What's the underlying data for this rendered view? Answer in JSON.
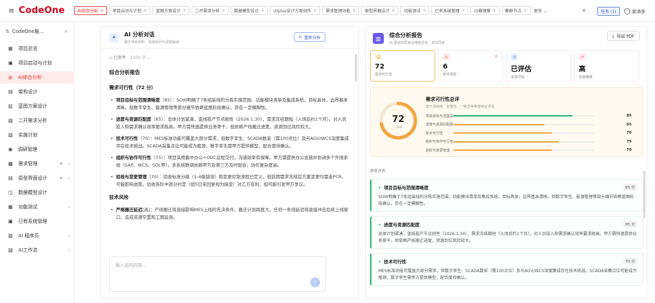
{
  "topbar": {
    "logo": "CodeOne",
    "tabs": [
      {
        "label": "AI综合分析",
        "active": true
      },
      {
        "label": "项目启动与计划"
      },
      {
        "label": "蓝图方案设计"
      },
      {
        "label": "二开需求分析"
      },
      {
        "label": "数据模型设计"
      },
      {
        "label": "Utplus设计方案创作"
      },
      {
        "label": "需求管理功能"
      },
      {
        "label": "原型界面设计"
      },
      {
        "label": "功能测试"
      },
      {
        "label": "已有系统管理"
      },
      {
        "label": "沙箱镜像"
      },
      {
        "label": "集群节点"
      }
    ],
    "more_label": "更多",
    "task_label": "任务 (1)",
    "user_name": "郭涛多"
  },
  "sidebar": {
    "project": "CodeOne施...",
    "items": [
      {
        "label": "项目总览"
      },
      {
        "label": "项目启动与计划"
      },
      {
        "label": "AI综合分析",
        "active": true
      },
      {
        "label": "架构设计"
      },
      {
        "label": "蓝图方案设计"
      },
      {
        "label": "二开需求分析"
      },
      {
        "label": "实施计划"
      },
      {
        "label": "调研管理"
      },
      {
        "label": "需求管理",
        "plus": true,
        "chev": true
      },
      {
        "label": "原型界面设计",
        "plus": true,
        "chev": true
      },
      {
        "label": "数据模型设计"
      },
      {
        "label": "功能测试",
        "chev": true
      },
      {
        "label": "已有系统管理"
      },
      {
        "label": "AI 程序员",
        "chev": true
      },
      {
        "label": "AI工作流",
        "chev": true
      }
    ]
  },
  "chat": {
    "title": "AI 分析对话",
    "subtitle": "基于项目材料 · 支持追问与深度解读",
    "regen_label": "重新分析",
    "thought_label": "已思考",
    "thought_count": "1100 字",
    "report_heading": "综合分析报告",
    "section1": "需求可行性（72 分）",
    "bullets": [
      {
        "b": "项目目标与范围清晰度",
        "t": "（85）：SOW明确了7条组装线的分拣实施范围、功能模块清单及集成系统，目标具体，边界基本清晰。但数字孪生、能源管理等部分细节依赖蓝图阶段确认，存在一定模糊性。"
      },
      {
        "b": "进度与资源匹配度",
        "t": "（65）：总体计划紧凑，蓝线投产节点刚性（2026.1.30），需求冻结期短（入场后约1个月）。对人员投入和需求确认效率要求极高。甲方需快速提供业务骨干，但依赖产线搬迁进度，资源到位风险较大。"
      },
      {
        "b": "技术可行性",
        "t": "（70）：MES标准功能可覆盖大部分需求，但数字孪生、SCADA数采（需100点位）及与AGV/WCS深度集成存在技术挑战。SCADA采集点位可能成为瓶颈，数字孪生需甲方提供模型，配合度待确认。"
      },
      {
        "b": "组织与协作可行性",
        "t": "（75）：项目采用集中办公+ODC远程交付，沟通效率有保障。甲方需提供办公设施并协调多个外围系统（SAP、WCS、SOL等），多系统联调依赖甲方及第三方及时配合，协作复杂度高。"
      },
      {
        "b": "验收与变更管理",
        "t": "（70）：验收标准分级（1-4级错误）和变更控制流程已定义，但前期需求冻结后方案变更均需走PCR，可能影响进度。验收各阶中部分约定（如5日未回复视为接受）对乙方有利，但可能引发甲方争议。"
      }
    ],
    "section2": "技术风险",
    "bullet_risk": {
      "b": "严格搬迁延迟",
      "t": "[高]：产线搬迁将直接影响MES上线的先决条件，搬迁计划跨度大，任何一条线延迟将直接冲击后续上线窗口，造成资源空置和工期延误。"
    },
    "input_placeholder": "输入追问内容…"
  },
  "report": {
    "title": "综合分析报告",
    "subtitle": "AI 驱动的项目全维度评估 · 实时同步",
    "export_label": "导出 PDF",
    "kpis": [
      {
        "value": "72",
        "label": "需求可行性",
        "icon": "smile-icon",
        "color": "#f0a030",
        "bg": "#fff3de"
      },
      {
        "value": "6",
        "label": "技术风险",
        "icon": "warning-icon",
        "color": "#e54848",
        "bg": "#ffe9e9",
        "badge": "2"
      },
      {
        "value": "已评估",
        "label": "资源评估",
        "icon": "clock-icon",
        "color": "#4a72d9",
        "bg": "#e9efff"
      },
      {
        "value": "高",
        "label": "实施难度",
        "icon": "trend-icon",
        "color": "#e0507a",
        "bg": "#ffe9f0"
      }
    ],
    "summary_title": "需求可行性总评",
    "summary_sub": "基于清晰度、完整性、一致性等维度综合评估",
    "score": "72",
    "score_total": "/ 100",
    "dimensions": [
      {
        "label": "项目目标与范围清晰度",
        "value": 85,
        "color": "#2bb673"
      },
      {
        "label": "进度与资源匹配度",
        "value": 65,
        "color": "#f2a640"
      },
      {
        "label": "技术可行性",
        "value": 70,
        "color": "#f2a640"
      },
      {
        "label": "组织与协作可行性",
        "value": 75,
        "color": "#f2a640"
      },
      {
        "label": "验收与变更管理",
        "value": 70,
        "color": "#f2a640"
      }
    ],
    "detail_label": "维度详情",
    "details": [
      {
        "title": "项目目标与范围清晰度",
        "score": "85 分",
        "text": "SOW明确了7条组装线的分拣实施范围、功能模块清单及集成系统，目标具体，边界基本清晰。但数字孪生、能源管理等部分细节依赖蓝图阶段确认，存在一定模糊性。"
      },
      {
        "title": "进度与资源匹配度",
        "score": "65 分",
        "text": "总体计划紧凑，蓝线投产节点刚性（2026.1.30），需求冻结期短（入场后约1个月）。对人员投入和需求确认效率要求极高。甲方需快速提供业务骨干，但依赖产线搬迁进度，资源到位风险较大。"
      },
      {
        "title": "技术可行性",
        "score": "70 分",
        "text": "MES标准功能可覆盖大部分需求，但数字孪生、SCADA数采（需100点位）及与AGV/WCS深度集成存在技术挑战。SCADA采集点位可能成为瓶颈，数字孪生需甲方提供模型，配合度待确认。"
      }
    ]
  }
}
